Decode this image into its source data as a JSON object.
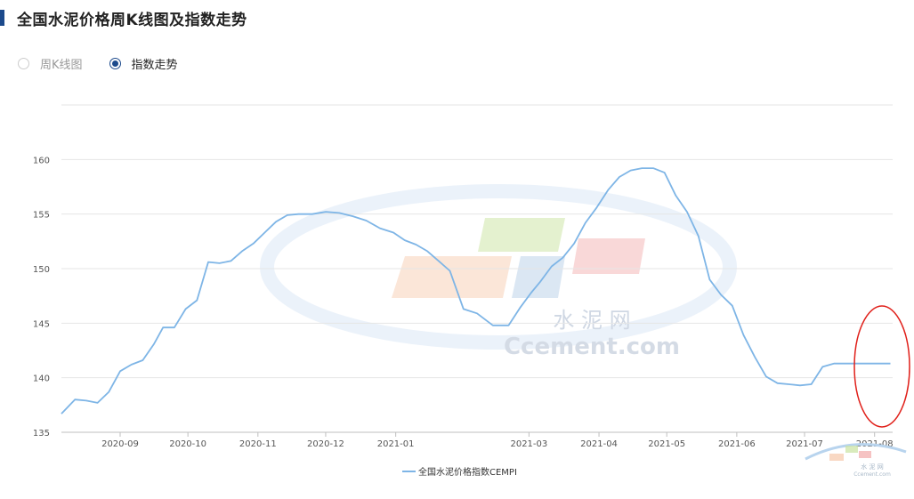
{
  "header": {
    "title": "全国水泥价格周K线图及指数走势"
  },
  "radio": [
    {
      "label": "周K线图",
      "checked": false
    },
    {
      "label": "指数走势",
      "checked": true
    }
  ],
  "watermark": {
    "cn": "水 泥 网",
    "en": "Ccement.com"
  },
  "colors": {
    "accent": "#1c4a8c",
    "line": "#7eb5e6",
    "annotation": "#e0201a"
  },
  "chart_data": {
    "type": "line",
    "title": "",
    "xlabel": "",
    "ylabel": "",
    "ylim": [
      135,
      165
    ],
    "yticks": [
      135,
      140,
      145,
      150,
      155,
      160
    ],
    "xlim": [
      "2020-08-06",
      "2021-08-09"
    ],
    "xticks": [
      "2020-09",
      "2020-10",
      "2020-11",
      "2020-12",
      "2021-01",
      "2021-03",
      "2021-04",
      "2021-05",
      "2021-06",
      "2021-07",
      "2021-08"
    ],
    "grid": true,
    "legend": "bottom-center",
    "annotation": "red-ellipse-around-latest-rise",
    "series": [
      {
        "name": "全国水泥价格指数CEMPI",
        "x": [
          "2020-08-06",
          "2020-08-12",
          "2020-08-17",
          "2020-08-22",
          "2020-08-27",
          "2020-09-01",
          "2020-09-06",
          "2020-09-11",
          "2020-09-16",
          "2020-09-20",
          "2020-09-25",
          "2020-09-30",
          "2020-10-05",
          "2020-10-10",
          "2020-10-15",
          "2020-10-20",
          "2020-10-25",
          "2020-10-30",
          "2020-11-04",
          "2020-11-09",
          "2020-11-14",
          "2020-11-19",
          "2020-11-25",
          "2020-12-01",
          "2020-12-07",
          "2020-12-13",
          "2020-12-19",
          "2020-12-25",
          "2020-12-31",
          "2021-01-05",
          "2021-01-10",
          "2021-01-15",
          "2021-01-20",
          "2021-01-25",
          "2021-01-31",
          "2021-02-06",
          "2021-02-13",
          "2021-02-20",
          "2021-02-25",
          "2021-03-02",
          "2021-03-06",
          "2021-03-11",
          "2021-03-16",
          "2021-03-21",
          "2021-03-26",
          "2021-03-31",
          "2021-04-05",
          "2021-04-10",
          "2021-04-15",
          "2021-04-20",
          "2021-04-25",
          "2021-04-30",
          "2021-05-05",
          "2021-05-10",
          "2021-05-15",
          "2021-05-20",
          "2021-05-25",
          "2021-05-30",
          "2021-06-04",
          "2021-06-09",
          "2021-06-14",
          "2021-06-19",
          "2021-06-24",
          "2021-06-29",
          "2021-07-04",
          "2021-07-09",
          "2021-07-14",
          "2021-07-19",
          "2021-07-24",
          "2021-07-29",
          "2021-08-02",
          "2021-08-04",
          "2021-08-06",
          "2021-08-08"
        ],
        "values": [
          136.7,
          138.0,
          137.9,
          137.7,
          138.7,
          140.6,
          141.2,
          141.6,
          143.1,
          144.6,
          144.6,
          146.3,
          147.1,
          150.6,
          150.5,
          150.7,
          151.6,
          152.3,
          153.3,
          154.3,
          154.9,
          155.0,
          155.0,
          155.2,
          155.1,
          154.8,
          154.4,
          153.7,
          153.3,
          152.6,
          152.2,
          151.6,
          150.7,
          149.8,
          146.3,
          145.9,
          144.8,
          144.8,
          146.4,
          147.8,
          148.8,
          150.2,
          151.0,
          152.3,
          154.2,
          155.6,
          157.2,
          158.4,
          159.0,
          159.2,
          159.2,
          158.8,
          156.7,
          155.2,
          153.0,
          149.0,
          147.6,
          146.6,
          143.9,
          141.9,
          140.1,
          139.5,
          139.4,
          139.3,
          139.4,
          141.0,
          141.3,
          141.3,
          141.3,
          141.3,
          141.3,
          141.3,
          141.3,
          141.3
        ]
      }
    ]
  }
}
